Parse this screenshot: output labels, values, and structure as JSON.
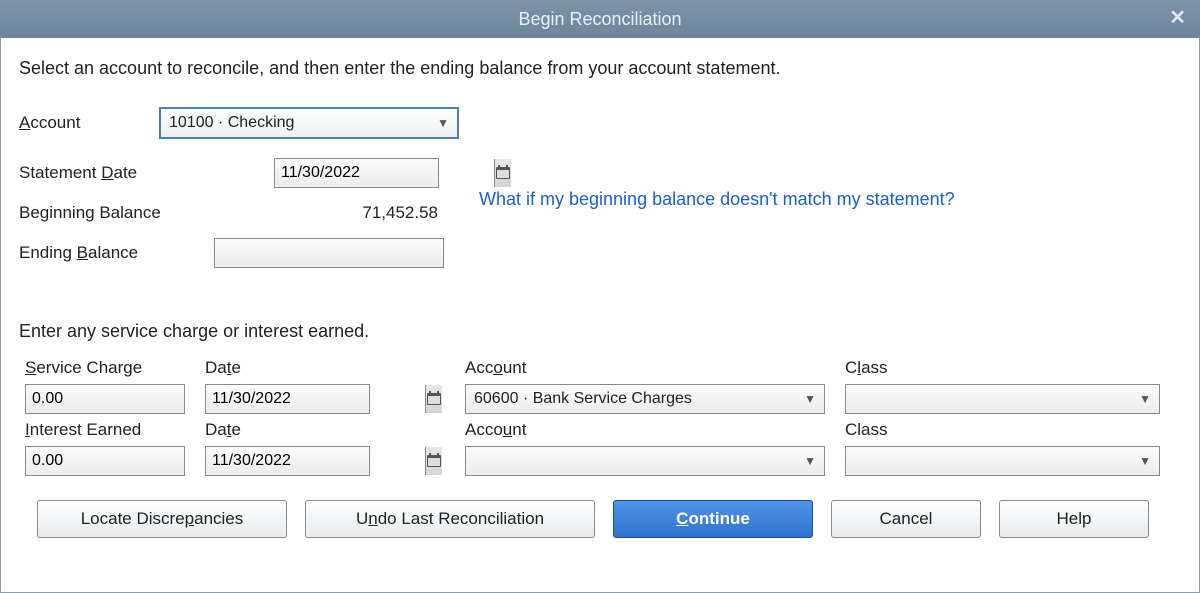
{
  "window": {
    "title": "Begin Reconciliation"
  },
  "intro": "Select an account to reconcile, and then enter the ending balance from your account statement.",
  "labels": {
    "account": "ccount",
    "statement_date": "Statement ",
    "statement_date_u": "D",
    "statement_date_rest": "ate",
    "beginning_balance": "Beginning Balance",
    "ending_balance_pre": "Ending ",
    "ending_balance_u": "B",
    "ending_balance_rest": "alance"
  },
  "account": {
    "selected": "10100 · Checking"
  },
  "statement_date": "11/30/2022",
  "beginning_balance": "71,452.58",
  "ending_balance": "",
  "help_link": "What if my beginning balance doesn't match my statement?",
  "charges_section_label": "Enter any service charge or interest earned.",
  "headers": {
    "service_charge_pre": "S",
    "service_charge_rest": "ervice Charge",
    "date_sc": "Da",
    "date_sc_u": "t",
    "date_sc_rest": "e",
    "account_sc": "Acc",
    "account_sc_u": "o",
    "account_sc_rest": "unt",
    "class_sc": "C",
    "class_sc_u": "l",
    "class_sc_rest": "ass",
    "interest_earned_pre": "I",
    "interest_earned_rest": "nterest Earned",
    "date_ie": "Da",
    "date_ie_u": "t",
    "date_ie_rest": "e",
    "account_ie": "Acco",
    "account_ie_u": "u",
    "account_ie_rest": "nt",
    "class_ie": "Class"
  },
  "service_charge": {
    "amount": "0.00",
    "date": "11/30/2022",
    "account": "60600 · Bank Service Charges",
    "class": ""
  },
  "interest_earned": {
    "amount": "0.00",
    "date": "11/30/2022",
    "account": "",
    "class": ""
  },
  "buttons": {
    "locate_pre": "Locate Discre",
    "locate_u": "p",
    "locate_rest": "ancies",
    "undo_pre": "U",
    "undo_u": "n",
    "undo_rest": "do Last Reconciliation",
    "continue_u": "C",
    "continue_rest": "ontinue",
    "cancel": "Cancel",
    "help": "Help"
  }
}
